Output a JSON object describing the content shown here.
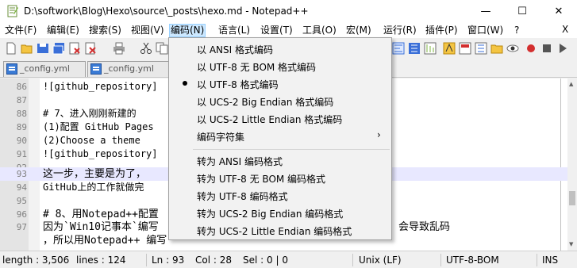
{
  "window": {
    "title": "D:\\softwork\\Blog\\Hexo\\source\\_posts\\hexo.md - Notepad++",
    "minimize": "—",
    "maximize": "☐",
    "close": "✕"
  },
  "menubar": {
    "items": [
      {
        "label": "文件(F)"
      },
      {
        "label": "编辑(E)"
      },
      {
        "label": "搜索(S)"
      },
      {
        "label": "视图(V)"
      },
      {
        "label": "编码(N)"
      },
      {
        "label": "语言(L)"
      },
      {
        "label": "设置(T)"
      },
      {
        "label": "工具(O)"
      },
      {
        "label": "宏(M)"
      },
      {
        "label": "运行(R)"
      },
      {
        "label": "插件(P)"
      },
      {
        "label": "窗口(W)"
      },
      {
        "label": "?"
      }
    ],
    "close_doc": "X",
    "active_index": 4
  },
  "toolbar": {
    "icons": [
      "new-file-icon",
      "open-file-icon",
      "save-icon",
      "save-all-icon",
      "close-icon",
      "close-all-icon",
      "print-icon",
      "cut-icon",
      "copy-icon",
      "paste-icon",
      "wrap-icon",
      "all-chars-icon",
      "indent-guide-icon",
      "lang-icon",
      "doc-map-icon",
      "function-list-icon",
      "folder-icon",
      "monitor-icon",
      "record-icon",
      "stop-icon",
      "play-icon",
      "play-multi-icon",
      "save-macro-icon"
    ]
  },
  "tabs": [
    {
      "label": "_config.yml"
    },
    {
      "label": "_config.yml"
    }
  ],
  "editor": {
    "lines": [
      {
        "num": "86",
        "text": "![github_repository]"
      },
      {
        "num": "87",
        "text": ""
      },
      {
        "num": "88",
        "text": "# 7、进入刚刚新建的"
      },
      {
        "num": "89",
        "text": "(1)配置 GitHub Pages"
      },
      {
        "num": "90",
        "text": "(2)Choose a theme"
      },
      {
        "num": "91",
        "text": "![github_repository]"
      },
      {
        "num": "92",
        "text": ""
      },
      {
        "num": "93",
        "text": "这一步，主要是为了，"
      },
      {
        "num": "94",
        "text": "GitHub上的工作就做完"
      },
      {
        "num": "95",
        "text": ""
      },
      {
        "num": "96",
        "text": "# 8、用Notepad++配置"
      },
      {
        "num": "97",
        "text": "因为`Win10记事本`编写"
      },
      {
        "num": "",
        "text": "，所以用Notepad++ 编写"
      }
    ],
    "overflow_text": "会导致乱码",
    "highlight_line": "93"
  },
  "dropdown": {
    "items": [
      {
        "label": "以 ANSI 格式编码",
        "checked": false
      },
      {
        "label": "以 UTF-8 无 BOM 格式编码",
        "checked": false
      },
      {
        "label": "以 UTF-8 格式编码",
        "checked": true
      },
      {
        "label": "以 UCS-2 Big Endian 格式编码",
        "checked": false
      },
      {
        "label": "以 UCS-2 Little Endian 格式编码",
        "checked": false
      },
      {
        "label": "编码字符集",
        "submenu": true
      }
    ],
    "convert_items": [
      {
        "label": "转为 ANSI 编码格式"
      },
      {
        "label": "转为 UTF-8 无 BOM 编码格式"
      },
      {
        "label": "转为 UTF-8 编码格式"
      },
      {
        "label": "转为 UCS-2 Big Endian 编码格式"
      },
      {
        "label": "转为 UCS-2 Little Endian 编码格式"
      }
    ],
    "submenu_arrow": "›"
  },
  "status": {
    "length": "length : 3,506",
    "lines": "lines : 124",
    "ln": "Ln : 93",
    "col": "Col : 28",
    "sel": "Sel : 0 | 0",
    "eol": "Unix (LF)",
    "encoding": "UTF-8-BOM",
    "mode": "INS"
  }
}
